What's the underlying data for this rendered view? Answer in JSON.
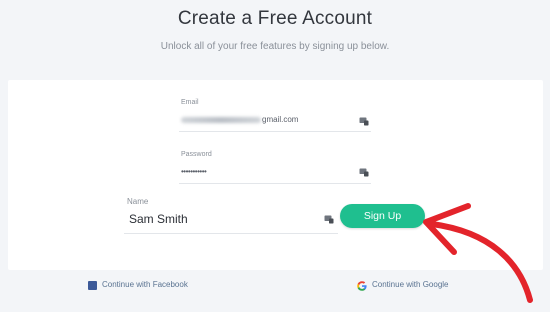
{
  "header": {
    "title": "Create a Free Account",
    "subtitle": "Unlock all of your free features by signing up below."
  },
  "form": {
    "email": {
      "label": "Email",
      "value_suffix": "gmail.com"
    },
    "password": {
      "label": "Password",
      "value": "•••••••••••"
    },
    "name": {
      "label": "Name",
      "value": "Sam Smith"
    },
    "signup_label": "Sign Up"
  },
  "social": {
    "facebook_label": "Continue with Facebook",
    "google_label": "Continue with Google"
  },
  "colors": {
    "accent": "#1fbf8f",
    "arrow": "#e3242b",
    "facebook": "#3b5998"
  },
  "icons": {
    "field_icon": "key-icon",
    "facebook_icon": "facebook-icon",
    "google_icon": "google-icon",
    "annotation": "red-arrow"
  }
}
